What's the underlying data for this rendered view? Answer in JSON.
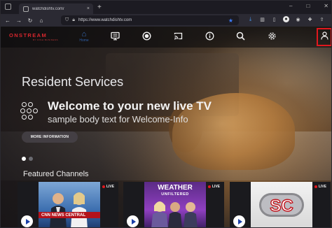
{
  "browser": {
    "tab_title": "watchdishtv.com/",
    "tab_close": "×",
    "new_tab": "+",
    "url": "https://www.watchdishtv.com",
    "window": {
      "minimize": "–",
      "maximize": "□",
      "close": "✕"
    }
  },
  "app": {
    "brand": "ONSTREAM",
    "brand_sub": "BY DISH BUSINESS",
    "home_label": "Home",
    "section_title": "Resident Services",
    "hero": {
      "title": "Welcome to your new live TV",
      "body": "sample body text for Welcome-Info",
      "button": "MORE INFORMATION",
      "pages": 2,
      "active_page": 1
    },
    "featured_title": "Featured Channels",
    "live_label": "LIVE",
    "channels": [
      {
        "name": "CNN News Central",
        "banner": "CNN NEWS CENTRAL"
      },
      {
        "name": "Weather Unfiltered",
        "title": "WEATHER",
        "subtitle": "UNFILTERED"
      },
      {
        "name": "SportsCenter",
        "logo_text": "SC"
      }
    ],
    "colors": {
      "brand_red": "#d7262d",
      "highlight_box": "#e0181e",
      "play_icon": "#1a3fa8"
    }
  }
}
